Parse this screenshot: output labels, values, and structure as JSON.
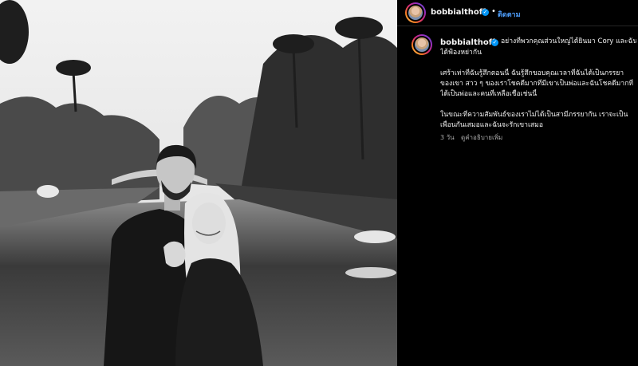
{
  "post": {
    "username": "bobbialthoff",
    "verified_glyph": "✓",
    "separator": "•",
    "follow_label": "ติดตาม",
    "image_alt": "Black and white photo of a couple on a canal bridge",
    "caption": {
      "lines": [
        "อย่างที่พวกคุณส่วนใหญ่ได้ยินมา Cory และฉัน",
        "ได้ฟ้องหย่ากัน",
        "เศร้าเท่าที่ฉันรู้สึกตอนนี้ ฉันรู้สึกขอบคุณเวลาที่ฉันได้เป็นภรรยา",
        "ของเขา สาว ๆ ของเราโชคดีมากที่มีเขาเป็นพ่อและฉันโชคดีมากที่",
        "ได้เป็นพ่อและคนที่เหลือเชื่อเช่นนี้",
        "ในขณะที่ความสัมพันธ์ของเราไม่ได้เป็นสามีภรรยากัน เราจะเป็น",
        "เพื่อนกันเสมอและฉันจะรักเขาเสมอ"
      ]
    },
    "time_ago": "3 วัน",
    "see_translation": "ดูคำอธิบายเพิ่ม"
  },
  "icons": {
    "avatar": "profile-avatar",
    "verified": "verified-badge-icon"
  },
  "colors": {
    "background": "#000000",
    "text": "#f5f5f5",
    "follow": "#4fa0ff",
    "verified": "#0095f6",
    "muted": "#a8a8a8"
  }
}
